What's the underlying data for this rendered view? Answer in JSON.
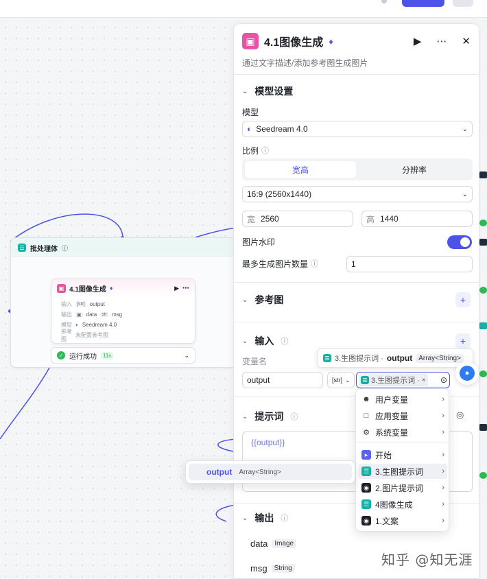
{
  "colors": {
    "accent": "#4d53e8",
    "success": "#2dba54",
    "teal": "#16b1a6",
    "pink": "#e952a5"
  },
  "canvas": {
    "batch": {
      "title": "批处理体",
      "icon": "layers-icon"
    },
    "node": {
      "title": "4.1图像生成",
      "input_label": "输入",
      "input_type": "[str]",
      "input_name": "output",
      "output_label": "输出",
      "output1": "data",
      "output2_type": "str",
      "output2": "msg",
      "model_label": "模型",
      "model": "Seedream 4.0",
      "ref_label": "参考图",
      "ref_value": "未配置参考图"
    },
    "status": {
      "text": "运行成功",
      "time": "11s"
    }
  },
  "panel": {
    "title": "4.1图像生成",
    "description": "通过文字描述/添加参考图生成图片",
    "model_section": {
      "title": "模型设置",
      "model_label": "模型",
      "model_value": "Seedream 4.0",
      "ratio_label": "比例",
      "tabs": [
        "宽高",
        "分辨率"
      ],
      "ratio_value": "16:9 (2560x1440)",
      "width_label": "宽",
      "width_value": "2560",
      "height_label": "高",
      "height_value": "1440",
      "watermark_label": "图片水印",
      "watermark_on": true,
      "max_count_label": "最多生成图片数量",
      "max_count_value": "1"
    },
    "reference_section": {
      "title": "参考图"
    },
    "input_section": {
      "title": "输入",
      "var_name_label": "变量名",
      "var_name": "output",
      "type_tag": "[str]",
      "ref_value": "3.生图提示词 ·"
    },
    "prompt_section": {
      "title": "提示词",
      "content": "{{output}}"
    },
    "output_section": {
      "title": "输出",
      "outputs": [
        {
          "name": "data",
          "type": "Image"
        },
        {
          "name": "msg",
          "type": "String"
        }
      ]
    }
  },
  "popover": {
    "source": "3.生图提示词 ·",
    "field": "output",
    "type": "Array<String>"
  },
  "dropdown": {
    "items": [
      {
        "label": "用户变量",
        "icon": "user-icon"
      },
      {
        "label": "应用变量",
        "icon": "folder-icon"
      },
      {
        "label": "系统变量",
        "icon": "gear-icon"
      },
      {
        "label": "开始",
        "icon": "start-icon"
      },
      {
        "label": "3.生图提示词",
        "icon": "layers-icon"
      },
      {
        "label": "2.图片提示词",
        "icon": "ai-icon"
      },
      {
        "label": "4图像生成",
        "icon": "layers-icon"
      },
      {
        "label": "1.文案",
        "icon": "ai-icon"
      }
    ]
  },
  "submenu": {
    "name": "output",
    "type": "Array<String>"
  },
  "watermark": "知乎 @知无涯"
}
